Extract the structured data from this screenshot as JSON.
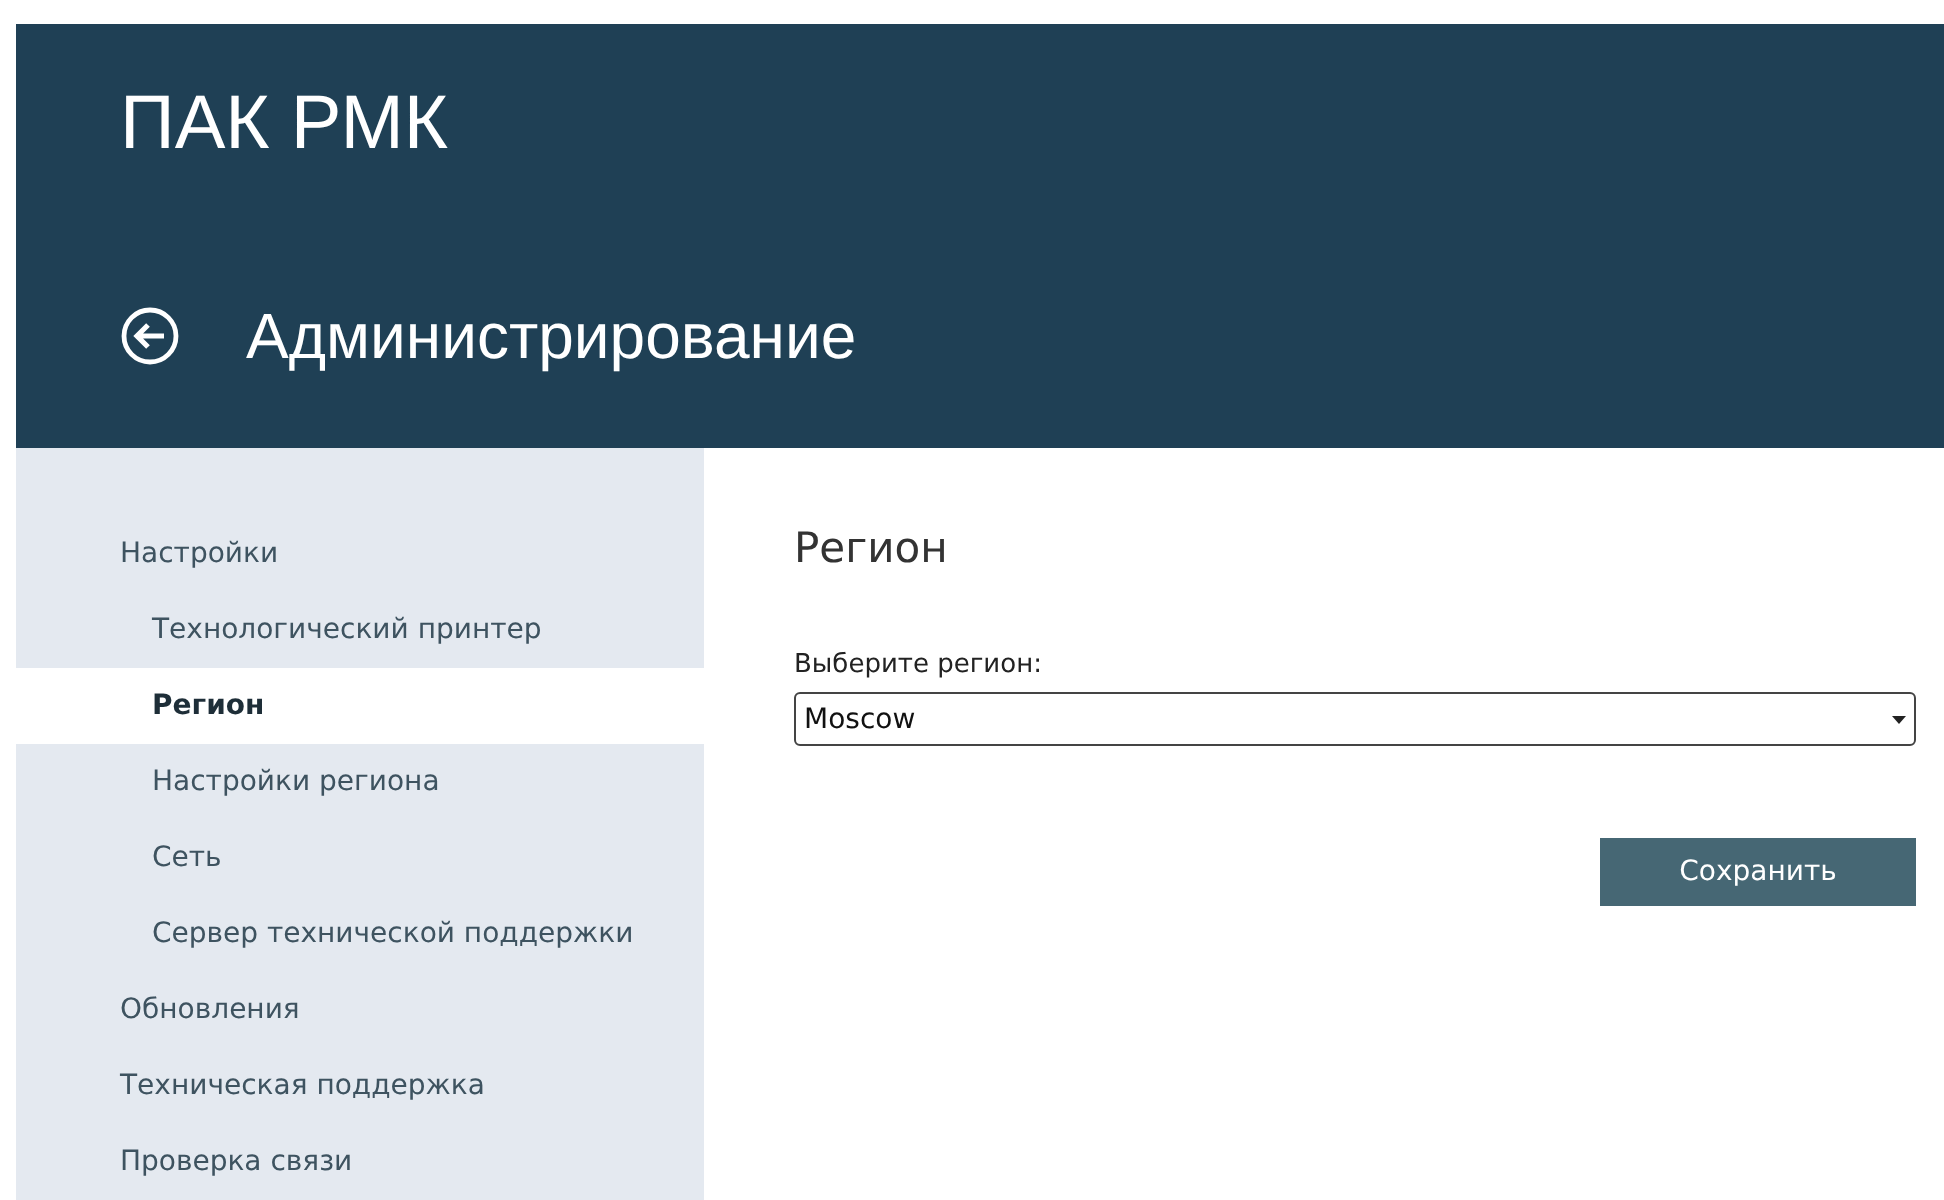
{
  "app": {
    "title": "ПАК РМК"
  },
  "page": {
    "title": "Администрирование"
  },
  "sidebar": {
    "items": [
      {
        "label": "Настройки",
        "selected": false,
        "children": [
          {
            "label": "Технологический принтер",
            "selected": false
          },
          {
            "label": "Регион",
            "selected": true
          },
          {
            "label": "Настройки региона",
            "selected": false
          },
          {
            "label": "Сеть",
            "selected": false
          },
          {
            "label": "Сервер технической поддержки",
            "selected": false
          }
        ]
      },
      {
        "label": "Обновления",
        "selected": false
      },
      {
        "label": "Техническая поддержка",
        "selected": false
      },
      {
        "label": "Проверка связи",
        "selected": false
      }
    ]
  },
  "content": {
    "title": "Регион",
    "field": {
      "label": "Выберите регион:",
      "value": "Moscow"
    },
    "buttons": [
      "Сохранить"
    ]
  }
}
